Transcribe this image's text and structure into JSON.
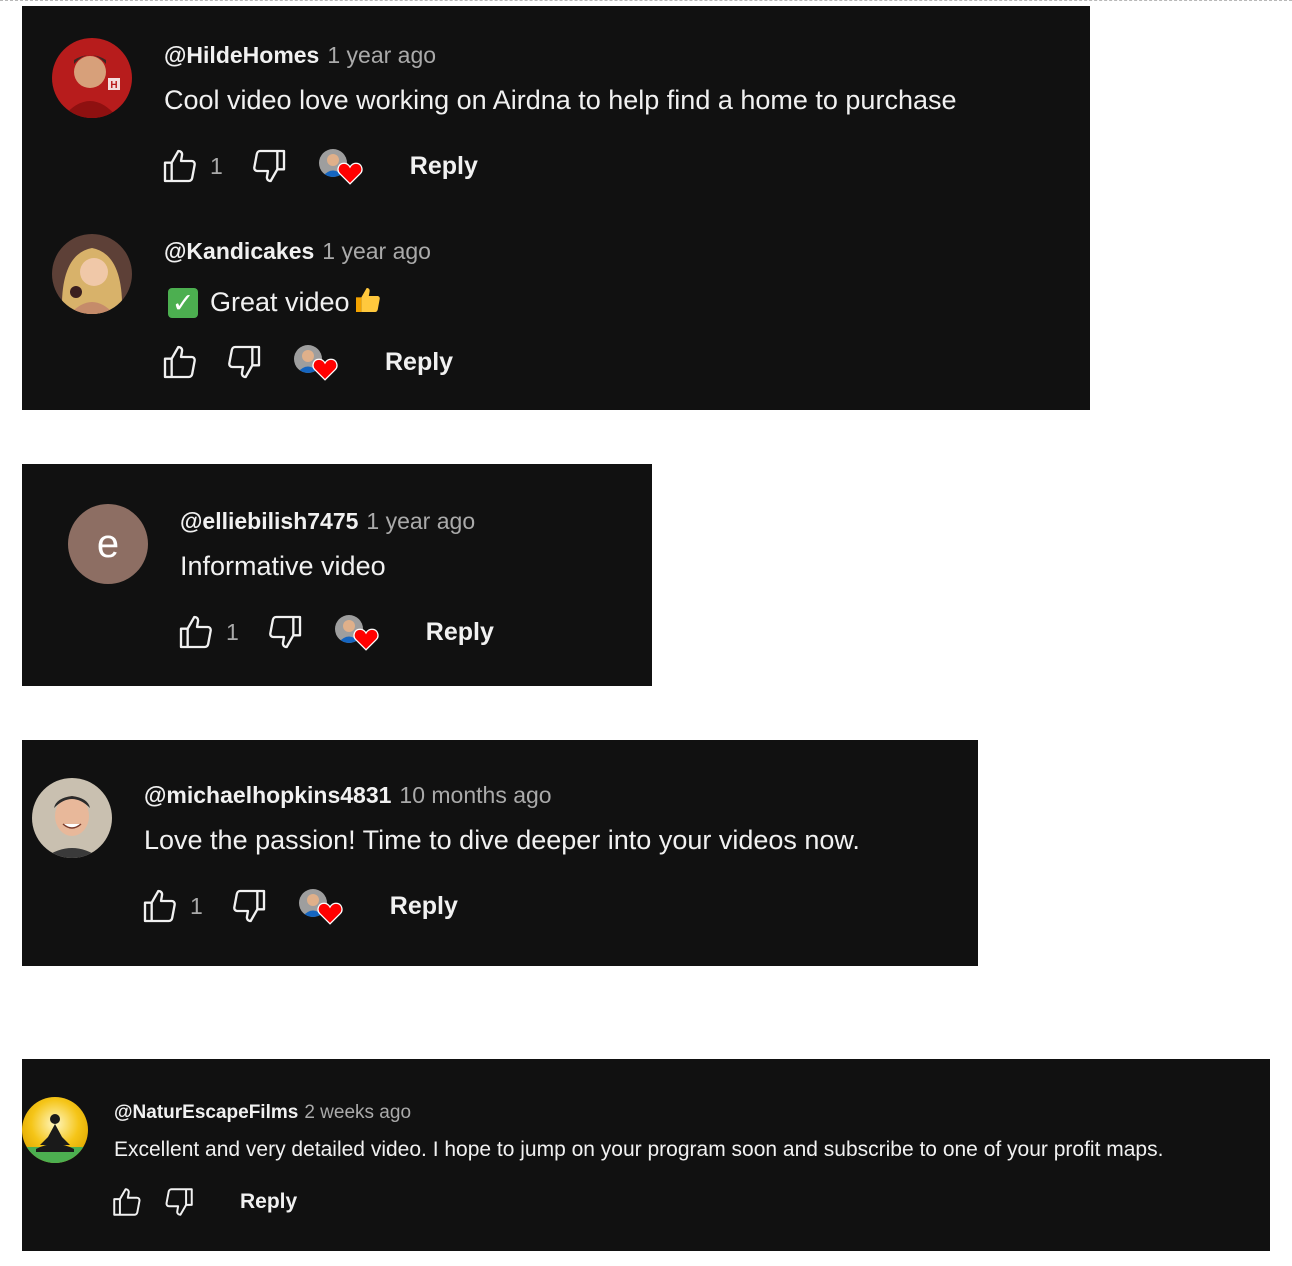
{
  "comments": [
    {
      "handle": "@HildeHomes",
      "time": "1 year ago",
      "text": "Cool video love working on Airdna to help find a home to purchase",
      "like_count": "1",
      "reply_label": "Reply",
      "avatar": "person-avatar-red"
    },
    {
      "handle": "@Kandicakes",
      "time": "1 year ago",
      "text": "Great video",
      "text_prefix_icon": "check-mark-icon",
      "text_suffix_icon": "thumbs-up-emoji-icon",
      "like_count": "",
      "reply_label": "Reply",
      "avatar": "person-avatar-blonde"
    },
    {
      "handle": "@elliebilish7475",
      "time": "1 year ago",
      "text": "Informative video",
      "like_count": "1",
      "reply_label": "Reply",
      "avatar_letter": "e",
      "avatar_color": "#8d6e63"
    },
    {
      "handle": "@michaelhopkins4831",
      "time": "10 months ago",
      "text": "Love the passion! Time to dive deeper into your videos now.",
      "like_count": "1",
      "reply_label": "Reply",
      "avatar": "person-avatar-smiling"
    },
    {
      "handle": "@NaturEscapeFilms",
      "time": "2 weeks ago",
      "text": "Excellent and very detailed video. I hope to jump on your program soon and subscribe to one of your profit maps.",
      "like_count": "",
      "reply_label": "Reply",
      "avatar": "meditation-logo-avatar"
    }
  ],
  "colors": {
    "panel": "#111111",
    "text": "#f1f1f1",
    "muted": "#aaaaaa",
    "heart": "#ff0000"
  }
}
